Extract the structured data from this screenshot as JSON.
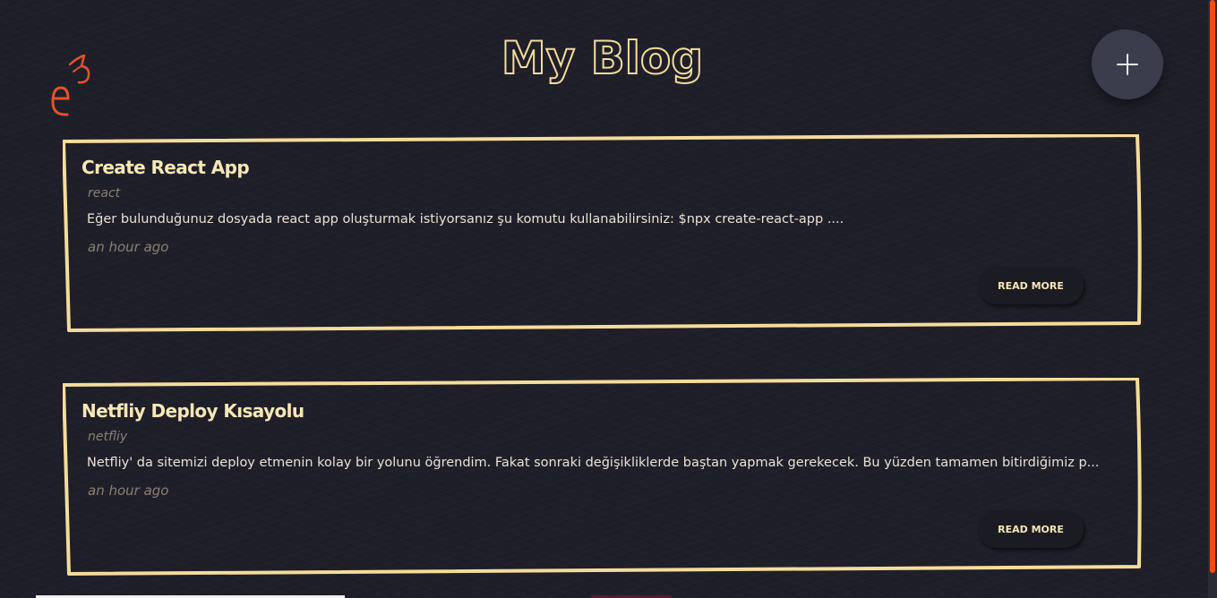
{
  "header": {
    "title": "My Blog",
    "logo_icon": "e3-logo-icon",
    "add_icon": "plus-icon"
  },
  "posts": [
    {
      "title": "Create React App",
      "tag": "react",
      "excerpt": "Eğer bulunduğunuz dosyada react app oluşturmak istiyorsanız şu komutu kullanabilirsiniz: $npx create-react-app ....",
      "time": "an hour ago",
      "read_more_label": "READ MORE"
    },
    {
      "title": "Netfliy Deploy Kısayolu",
      "tag": "netfliy",
      "excerpt": "Netfliy' da sitemizi deploy etmenin kolay bir yolunu öğrendim. Fakat sonraki değişikliklerde baştan yapmak gerekecek. Bu yüzden tamamen bitirdiğimiz p...",
      "time": "an hour ago",
      "read_more_label": "READ MORE"
    }
  ],
  "colors": {
    "background": "#1f1f29",
    "accent": "#f4dc9b",
    "logo": "#e2532a",
    "scroll_thumb": "#ff4a0e"
  }
}
